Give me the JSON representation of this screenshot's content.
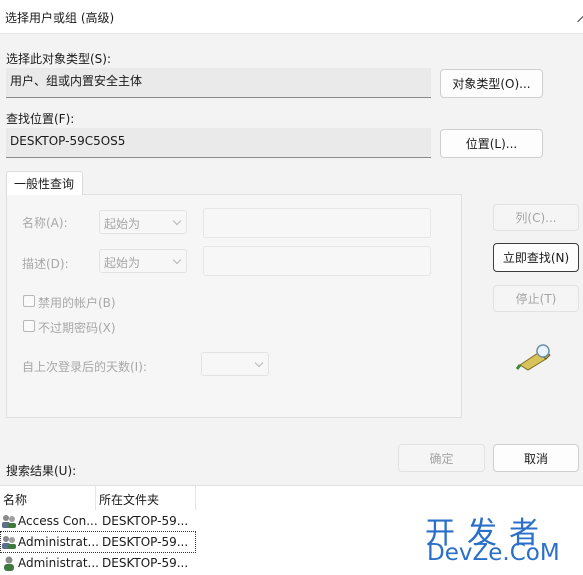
{
  "window": {
    "title": "选择用户或组 (高级)"
  },
  "object_type": {
    "label": "选择此对象类型(S):",
    "value": "用户、组或内置安全主体",
    "button": "对象类型(O)..."
  },
  "location": {
    "label": "查找位置(F):",
    "value": "DESKTOP-59C5OS5",
    "button": "位置(L)..."
  },
  "general_query": {
    "tab": "一般性查询",
    "name_label": "名称(A):",
    "name_mode": "起始为",
    "desc_label": "描述(D):",
    "desc_mode": "起始为",
    "disabled_accounts": "禁用的帐户(B)",
    "non_expiring_pw": "不过期密码(X)",
    "days_since_logon": "自上次登录后的天数(I):"
  },
  "side_buttons": {
    "columns": "列(C)...",
    "find_now": "立即查找(N)",
    "stop": "停止(T)"
  },
  "dialog_buttons": {
    "ok": "确定",
    "cancel": "取消"
  },
  "results": {
    "label": "搜索结果(U):",
    "columns": [
      "名称",
      "所在文件夹"
    ],
    "rows": [
      {
        "name": "Access Con...",
        "folder": "DESKTOP-59..."
      },
      {
        "name": "Administrat...",
        "folder": "DESKTOP-59..."
      },
      {
        "name": "Administrat...",
        "folder": "DESKTOP-59..."
      }
    ]
  },
  "watermark": {
    "line1": "开发者",
    "line2": "DevZe.CoM"
  }
}
